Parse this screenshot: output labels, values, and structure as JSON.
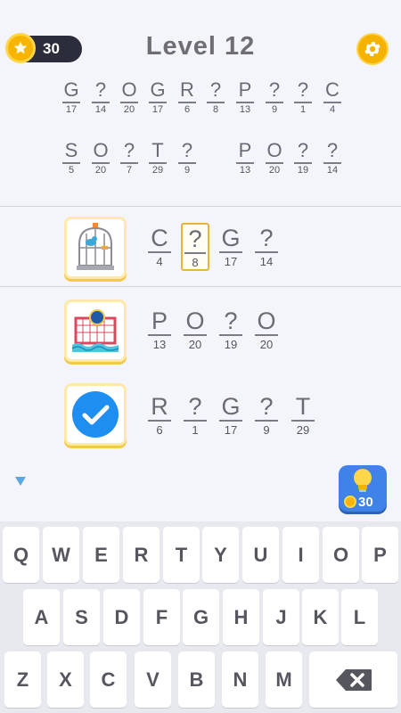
{
  "header": {
    "coins": "30",
    "level_title": "Level 12",
    "coin_icon": "star-coin-icon",
    "settings_icon": "gear-icon"
  },
  "phrase": {
    "line1": [
      {
        "ch": "G",
        "num": "17"
      },
      {
        "ch": "?",
        "num": "14"
      },
      {
        "ch": "O",
        "num": "20"
      },
      {
        "ch": "G",
        "num": "17"
      },
      {
        "ch": "R",
        "num": "6"
      },
      {
        "ch": "?",
        "num": "8"
      },
      {
        "ch": "P",
        "num": "13"
      },
      {
        "ch": "?",
        "num": "9"
      },
      {
        "ch": "?",
        "num": "1"
      },
      {
        "ch": "C",
        "num": "4"
      }
    ],
    "line2_word1": [
      {
        "ch": "S",
        "num": "5"
      },
      {
        "ch": "O",
        "num": "20"
      },
      {
        "ch": "?",
        "num": "7"
      },
      {
        "ch": "T",
        "num": "29"
      },
      {
        "ch": "?",
        "num": "9"
      }
    ],
    "line2_word2": [
      {
        "ch": "P",
        "num": "13"
      },
      {
        "ch": "O",
        "num": "20"
      },
      {
        "ch": "?",
        "num": "19"
      },
      {
        "ch": "?",
        "num": "14"
      }
    ]
  },
  "clues": [
    {
      "icon": "birdcage-icon",
      "cells": [
        {
          "ch": "C",
          "num": "4"
        },
        {
          "ch": "?",
          "num": "8"
        },
        {
          "ch": "G",
          "num": "17"
        },
        {
          "ch": "?",
          "num": "14"
        }
      ]
    },
    {
      "icon": "water-polo-goal-icon",
      "cells": [
        {
          "ch": "P",
          "num": "13"
        },
        {
          "ch": "O",
          "num": "20"
        },
        {
          "ch": "?",
          "num": "19"
        },
        {
          "ch": "O",
          "num": "20"
        }
      ]
    },
    {
      "icon": "checkmark-icon",
      "cells": [
        {
          "ch": "R",
          "num": "6"
        },
        {
          "ch": "?",
          "num": "1"
        },
        {
          "ch": "G",
          "num": "17"
        },
        {
          "ch": "?",
          "num": "9"
        },
        {
          "ch": "T",
          "num": "29"
        }
      ]
    }
  ],
  "hint": {
    "cost": "30",
    "icon": "lightbulb-icon"
  },
  "keyboard": {
    "row1": [
      "Q",
      "W",
      "E",
      "R",
      "T",
      "Y",
      "U",
      "I",
      "O",
      "P"
    ],
    "row2": [
      "A",
      "S",
      "D",
      "F",
      "G",
      "H",
      "J",
      "K",
      "L"
    ],
    "row3": [
      "Z",
      "X",
      "C",
      "V",
      "B",
      "N",
      "M"
    ],
    "backspace_icon": "backspace-icon"
  },
  "colors": {
    "background": "#f4f5fa",
    "accent_gold": "#f5b300",
    "hint_blue": "#3f82e8",
    "text_gray": "#6b6b73"
  }
}
